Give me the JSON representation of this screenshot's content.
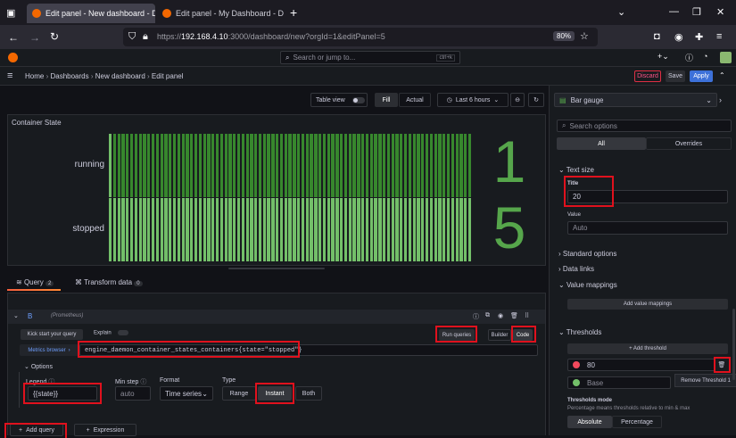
{
  "browser": {
    "tabs": [
      {
        "title": "Edit panel - New dashboard - D",
        "active": true
      },
      {
        "title": "Edit panel - My Dashboard - Da",
        "active": false
      }
    ],
    "url_prefix": "https://",
    "url_host": "192.168.4.10",
    "url_rest": ":3000/dashboard/new?orgId=1&editPanel=5",
    "zoom": "80%"
  },
  "grafana": {
    "search_placeholder": "Search or jump to...",
    "search_shortcut": "ctrl+k",
    "breadcrumb": [
      "Home",
      "Dashboards",
      "New dashboard",
      "Edit panel"
    ],
    "discard": "Discard",
    "save": "Save",
    "apply": "Apply"
  },
  "toolbar": {
    "table_view": "Table view",
    "fill": "Fill",
    "actual": "Actual",
    "time_range": "Last 6 hours"
  },
  "panel": {
    "title": "Container State",
    "rows": [
      {
        "label": "running",
        "value": "1",
        "fill_fraction": 1.0
      },
      {
        "label": "stopped",
        "value": "5",
        "fill_fraction": 1.0
      }
    ]
  },
  "query_tabs": {
    "query": "Query",
    "query_count": "2",
    "transform": "Transform data",
    "transform_count": "0"
  },
  "query": {
    "ref": "B",
    "datasource": "(Prometheus)",
    "kick_start": "Kick start your query",
    "explain": "Explain",
    "run_queries": "Run queries",
    "builder": "Builder",
    "code": "Code",
    "metrics_browser": "Metrics browser",
    "expr": "engine_daemon_container_states_containers{state=\"stopped\"}",
    "options": "Options",
    "legend_label": "Legend",
    "legend_value": "{{state}}",
    "min_step_label": "Min step",
    "min_step_placeholder": "auto",
    "format_label": "Format",
    "format_value": "Time series",
    "type_label": "Type",
    "type_options": [
      "Range",
      "Instant",
      "Both"
    ],
    "add_query": "Add query",
    "expression": "Expression"
  },
  "options_pane": {
    "viz": "Bar gauge",
    "search_placeholder": "Search options",
    "tab_all": "All",
    "tab_overrides": "Overrides",
    "text_size": "Text size",
    "title_label": "Title",
    "title_value": "20",
    "value_label": "Value",
    "value_placeholder": "Auto",
    "standard_options": "Standard options",
    "data_links": "Data links",
    "value_mappings": "Value mappings",
    "add_value_mappings": "Add value mappings",
    "thresholds": "Thresholds",
    "add_threshold": "+ Add threshold",
    "threshold_value": "80",
    "threshold_base": "Base",
    "remove_tooltip": "Remove Threshold 1",
    "thresholds_mode": "Thresholds mode",
    "thresholds_mode_desc": "Percentage means thresholds relative to min & max",
    "mode_absolute": "Absolute",
    "mode_percentage": "Percentage"
  },
  "colors": {
    "bar_green": "#73bf69",
    "bar_dark": "#37872d",
    "value_green": "#56a64b",
    "accent": "#3d71d9",
    "highlight": "#e0111d",
    "threshold_red": "#f2495c"
  }
}
